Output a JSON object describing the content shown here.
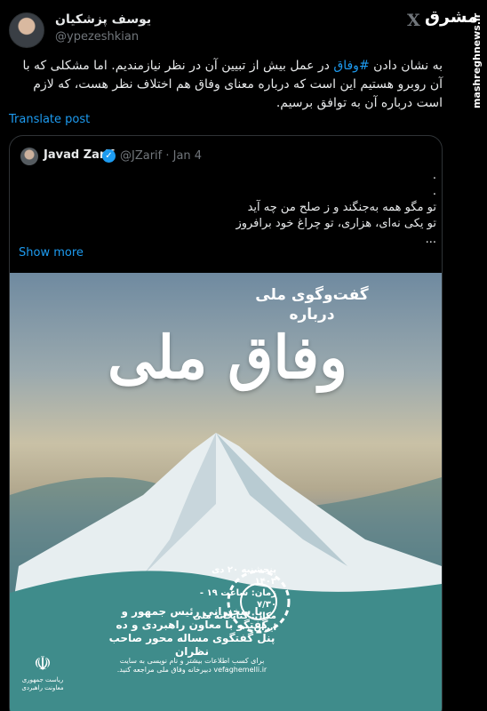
{
  "author": {
    "name": "یوسف پزشکیان",
    "handle": "@ypezeshkian"
  },
  "watermark": {
    "brand": "مشرق",
    "site": "mashreghnews.ir"
  },
  "post": {
    "text_before": "به نشان دادن ",
    "hashtag": "#وفاق",
    "text_after": " در عمل بیش از تبیین آن در نظر نیازمندیم. اما مشکلی که با آن روبرو هستیم این است که درباره معنای وفاق هم اختلاف نظر هست، که لازم است درباره آن به توافق برسیم.",
    "translate_label": "Translate post"
  },
  "quoted": {
    "name": "Javad Zarif",
    "verified_mark": "✓",
    "meta": "@JZarif · Jan 4",
    "body": ".\n.\nتو مگو همه به‌جنگند و ز صلح من چه آید\nتو یکی نه‌ای، هزاری، تو چراغ خود برافروز\n...",
    "show_more": "Show more"
  },
  "poster": {
    "subtitle": "گفت‌وگوی ملی درباره",
    "title": "وفاق ملی",
    "info": "پنجشنبه ۲۰ دی ۱۴۰۳\nزمان: ساعت ۱۹ - ۷/۳۰\nمکان: کتابخانه ملی ایران",
    "speech": "با سخنرانی رئیس جمهور و گفتگو با معاون راهبردی و ده پنل گفتگوی مساله محور صاحب نظران",
    "footer": "برای کسب اطلاعات بیشتر و نام نویسی به سایت vefaghemelli.ir دبیرخانه وفاق ملی مراجعه کنید.",
    "emblem_text": "ریاست جمهوری\nمعاونت راهبردی"
  },
  "colors": {
    "accent": "#1d9bf0",
    "background": "#000000",
    "border": "#2f3336",
    "muted": "#71767b"
  }
}
